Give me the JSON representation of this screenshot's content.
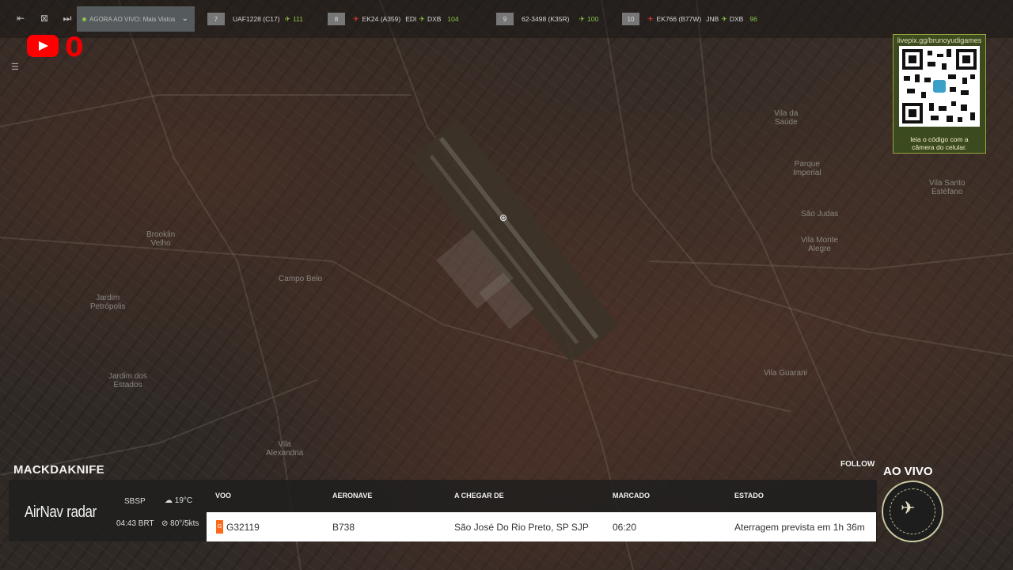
{
  "topbar": {
    "live_label": "AGORA AO VIVO: Mais Vistos",
    "flights": [
      {
        "rank": "7",
        "callsign": "UAF1228 (C17)",
        "route": "",
        "count": "111",
        "color": "green"
      },
      {
        "rank": "8",
        "callsign": "EK24 (A359)",
        "route_from": "EDI",
        "route_to": "DXB",
        "count": "104",
        "color": "red"
      },
      {
        "rank": "9",
        "callsign": "62-3498 (K35R)",
        "route": "",
        "count": "100",
        "color": "green"
      },
      {
        "rank": "10",
        "callsign": "EK766 (B77W)",
        "route_from": "JNB",
        "route_to": "DXB",
        "count": "96",
        "color": "red"
      }
    ]
  },
  "youtube": {
    "count": "0"
  },
  "qr": {
    "url": "livepix.gg/brunoyudigames",
    "caption_line1": "leia o código com a",
    "caption_line2": "câmera do celular."
  },
  "map_labels": [
    {
      "text": "Brooklin\nVelho"
    },
    {
      "text": "Campo Belo"
    },
    {
      "text": "Jardim\nPetrópolis"
    },
    {
      "text": "Jardim dos\nEstados"
    },
    {
      "text": "Vila\nAlexandria"
    },
    {
      "text": "Vila da\nSaúde"
    },
    {
      "text": "Parque\nImperial"
    },
    {
      "text": "São Judas"
    },
    {
      "text": "Vila Monte\nAlegre"
    },
    {
      "text": "Vila Guarani"
    },
    {
      "text": "Vila Santo\nEstéfano"
    }
  ],
  "panel": {
    "username": "MACKDAKNIFE",
    "follow": "FOLLOW",
    "brand_main": "AirNav",
    "brand_sub": "radar",
    "airport": "SBSP",
    "time": "04:43 BRT",
    "temperature": "19°C",
    "wind": "80°/5kts",
    "headers": {
      "flight": "VOO",
      "aircraft": "AERONAVE",
      "origin": "A CHEGAR DE",
      "scheduled": "MARCADO",
      "status": "ESTADO"
    },
    "row": {
      "flight": "G32119",
      "airline_logo": "G",
      "aircraft": "B738",
      "origin": "São José Do Rio Preto, SP SJP",
      "scheduled": "06:20",
      "status": "Aterragem prevista em 1h 36m"
    }
  },
  "live_badge": {
    "label": "AO VIVO"
  },
  "colors": {
    "green": "#8bc34a",
    "red": "#e53935",
    "youtube": "#ff0000",
    "airline": "#ff6a1a"
  }
}
